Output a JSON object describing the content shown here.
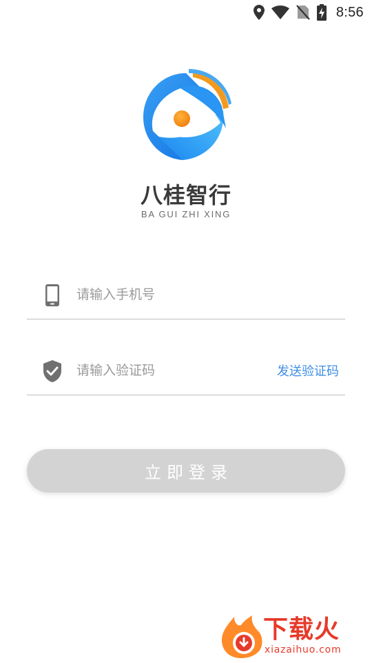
{
  "status_bar": {
    "time": "8:56",
    "icons": [
      "location-icon",
      "wifi-icon",
      "no-sim-icon",
      "battery-charging-icon"
    ]
  },
  "brand": {
    "name": "八桂智行",
    "pinyin": "BA GUI ZHI XING",
    "logo_colors": [
      "#1e90ff",
      "#2ca6f5",
      "#f39a1e",
      "#ffffff"
    ]
  },
  "form": {
    "phone": {
      "placeholder": "请输入手机号",
      "value": "",
      "icon": "phone-icon"
    },
    "code": {
      "placeholder": "请输入验证码",
      "value": "",
      "icon": "shield-check-icon",
      "send_label": "发送验证码"
    }
  },
  "login_button": {
    "label": "立即登录"
  },
  "watermark": {
    "text": "下载火",
    "url": "xiazaihuo.com"
  },
  "colors": {
    "accent": "#3e8ee3",
    "button_disabled": "#d3d3d3",
    "watermark": "#e63a2a"
  }
}
